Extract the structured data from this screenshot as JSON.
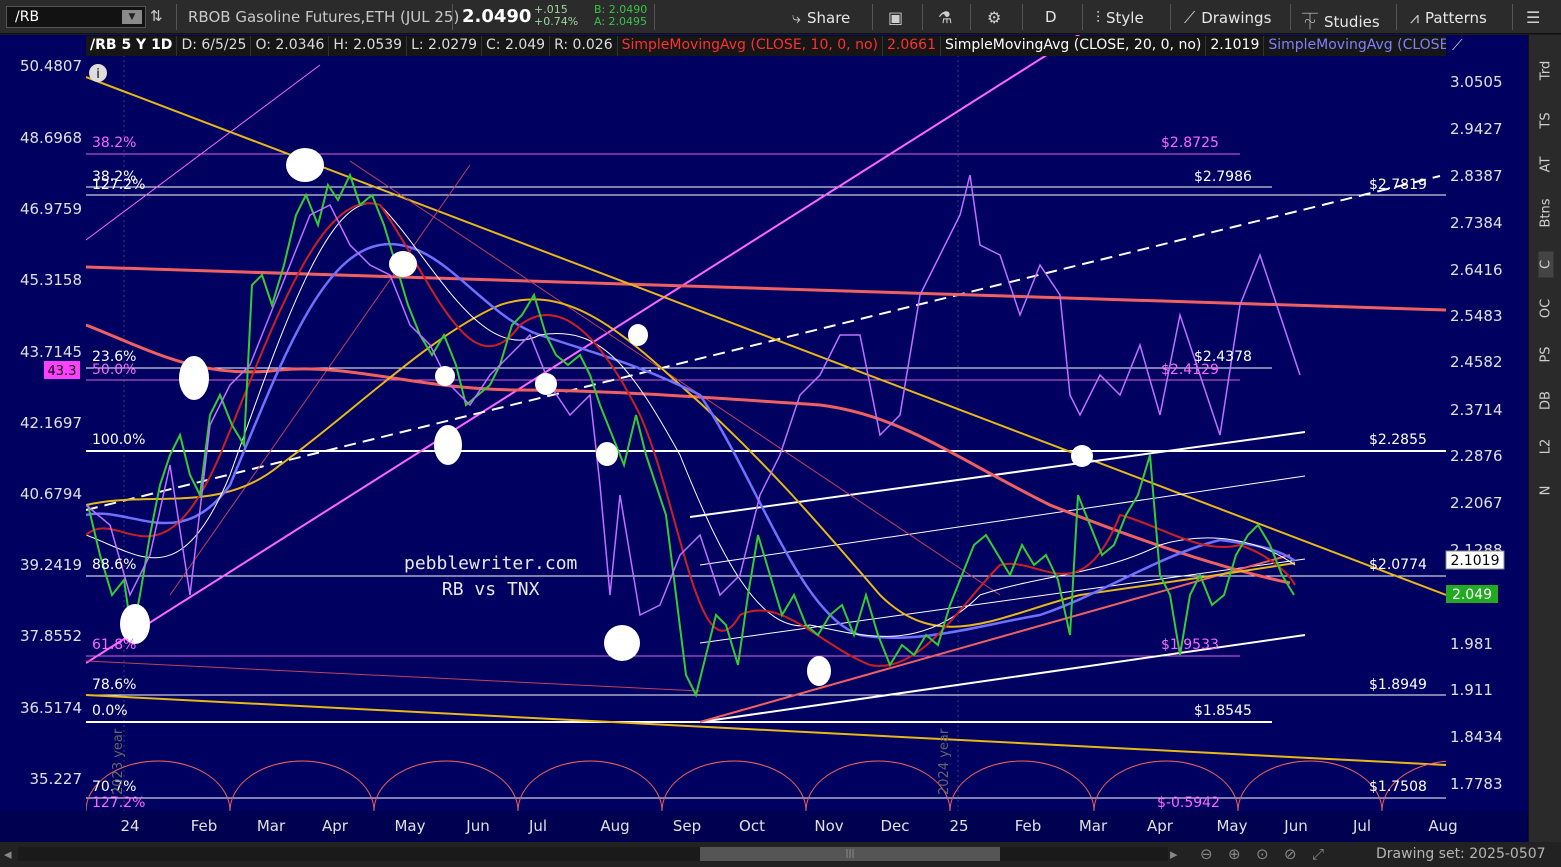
{
  "toolbar": {
    "symbol": "/RB",
    "description": "RBOB Gasoline Futures,ETH (JUL 25)",
    "last": "2.0490",
    "net_change": "+.015",
    "pct_change": "+0.74%",
    "bid": "B: 2.0490",
    "ask": "A: 2.0495",
    "share": "Share",
    "timeframe": "D",
    "style": "Style",
    "drawings": "Drawings",
    "studies": "Studies",
    "patterns": "Patterns"
  },
  "header": {
    "symbol": "/RB 5 Y 1D",
    "date": "D: 6/5/25",
    "open": "O: 2.0346",
    "high": "H: 2.0539",
    "low": "L: 2.0279",
    "close": "C: 2.049",
    "range": "R: 0.026",
    "sma10": "SimpleMovingAvg (CLOSE, 10, 0, no)",
    "sma10_val": "2.0661",
    "sma20": "SimpleMovingAvg (CLOSE, 20, 0, no)",
    "sma20_val": "2.1019",
    "sma50": "SimpleMovingAvg (CLOSE,..."
  },
  "watermark": {
    "line1": "pebblewriter.com",
    "line2": "RB vs TNX"
  },
  "chart_data": {
    "type": "line",
    "x_ticks": [
      "24",
      "Feb",
      "Mar",
      "Apr",
      "May",
      "Jun",
      "Jul",
      "Aug",
      "Sep",
      "Oct",
      "Nov",
      "Dec",
      "25",
      "Feb",
      "Mar",
      "Apr",
      "May",
      "Jun",
      "Jul",
      "Aug"
    ],
    "right_axis": [
      "3.0505",
      "2.9427",
      "2.8387",
      "2.7384",
      "2.6416",
      "2.5483",
      "2.4582",
      "2.3714",
      "2.2876",
      "2.2067",
      "2.1288",
      "1.981",
      "1.911",
      "1.8434",
      "1.7783"
    ],
    "left_axis": [
      "50.4807",
      "48.6968",
      "46.9759",
      "45.3158",
      "43.7145",
      "42.1697",
      "40.6794",
      "39.2419",
      "37.8552",
      "36.5174",
      "35.227"
    ],
    "price_labels": [
      "$2.8725",
      "$2.7986",
      "$2.7819",
      "$2.4378",
      "$2.4129",
      "$2.2855",
      "$2.0774",
      "$1.9533",
      "$1.8949",
      "$1.8545",
      "$1.7508",
      "$-0.5942"
    ],
    "fib_labels": [
      "38.2%",
      "38.2%",
      "127.2%",
      "23.6%",
      "50.0%",
      "100.0%",
      "88.6%",
      "61.8%",
      "78.6%",
      "0.0%",
      "70.7%",
      "127.2%"
    ],
    "current_tnx": "43.3",
    "current_sma": "2.1019",
    "current_price": "2.049",
    "year_labels": [
      "2023 year",
      "2024 year"
    ]
  },
  "sidebar": [
    "Trd",
    "TS",
    "AT",
    "Btns",
    "C",
    "OC",
    "PS",
    "DB",
    "L2",
    "N"
  ],
  "bottom": {
    "drawing_set": "Drawing set: 2025-0507"
  },
  "colors": {
    "bg": "#000060",
    "yellow": "#e8b818",
    "red": "#f06060",
    "magenta": "#e060e0",
    "blue": "#7070ff"
  }
}
